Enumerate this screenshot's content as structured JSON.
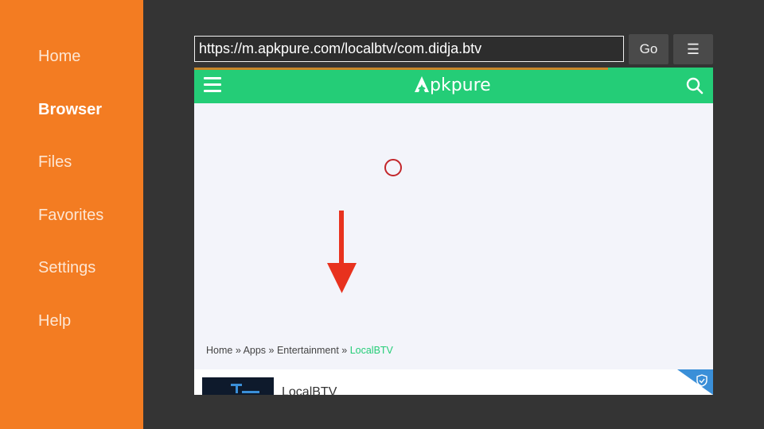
{
  "sidebar": {
    "items": [
      {
        "label": "Home",
        "active": false
      },
      {
        "label": "Browser",
        "active": true
      },
      {
        "label": "Files",
        "active": false
      },
      {
        "label": "Favorites",
        "active": false
      },
      {
        "label": "Settings",
        "active": false
      },
      {
        "label": "Help",
        "active": false
      }
    ]
  },
  "toolbar": {
    "url": "https://m.apkpure.com/localbtv/com.didja.btv",
    "go_label": "Go",
    "menu_label": "☰"
  },
  "webpage": {
    "logo_text": "pkpure",
    "breadcrumb": {
      "home": "Home",
      "sep": " » ",
      "apps": "Apps",
      "category": "Entertainment",
      "current": "LocalBTV"
    },
    "app": {
      "name": "LocalBTV"
    },
    "colors": {
      "brand": "#24cd77",
      "sidebar": "#f37c22",
      "annotation": "#e8321e"
    }
  }
}
